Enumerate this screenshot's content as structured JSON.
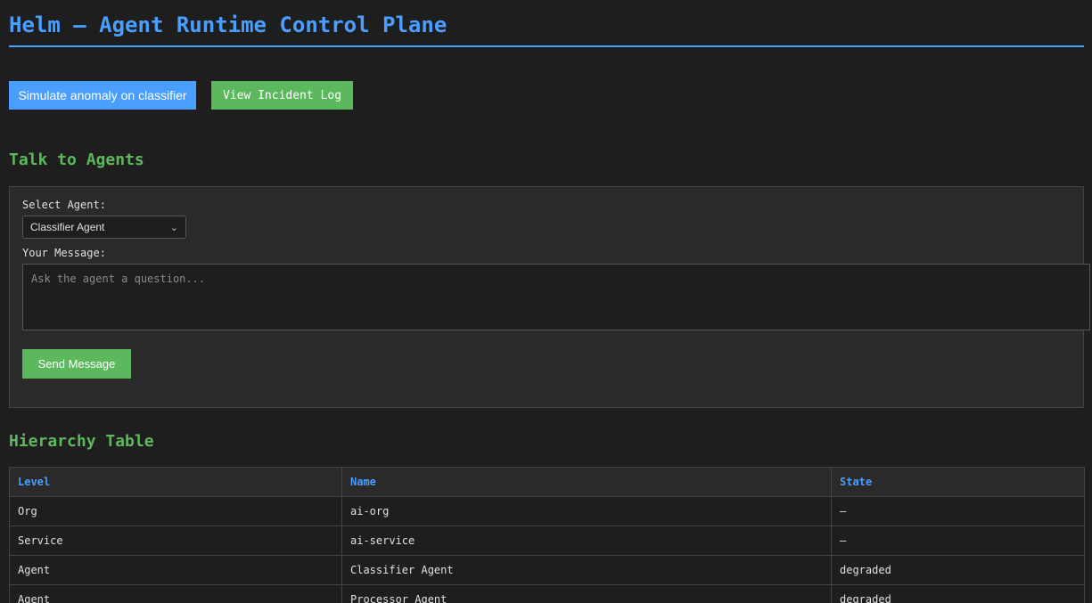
{
  "header": {
    "title": "Helm — Agent Runtime Control Plane"
  },
  "actions": {
    "simulate_label": "Simulate anomaly on classifier",
    "incident_label": "View Incident Log"
  },
  "talk": {
    "heading": "Talk to Agents",
    "select_label": "Select Agent:",
    "selected_agent": "Classifier Agent",
    "message_label": "Your Message:",
    "message_value": "",
    "message_placeholder": "Ask the agent a question...",
    "send_label": "Send Message"
  },
  "hierarchy": {
    "heading": "Hierarchy Table",
    "columns": [
      "Level",
      "Name",
      "State"
    ],
    "rows": [
      {
        "level": "Org",
        "name": "ai-org",
        "state": "—",
        "depth": 0
      },
      {
        "level": "Service",
        "name": "ai-service",
        "state": "—",
        "depth": 1
      },
      {
        "level": "Agent",
        "name": "Classifier Agent",
        "state": "degraded",
        "depth": 2
      },
      {
        "level": "Agent",
        "name": "Processor Agent",
        "state": "degraded",
        "depth": 2
      }
    ]
  },
  "colors": {
    "accent_blue": "#4a9eff",
    "accent_green": "#5cb85c",
    "degraded_red": "#ff4d4d",
    "background": "#1e1e1e"
  },
  "icons": {
    "select_chevron": "chevron-down-icon"
  }
}
